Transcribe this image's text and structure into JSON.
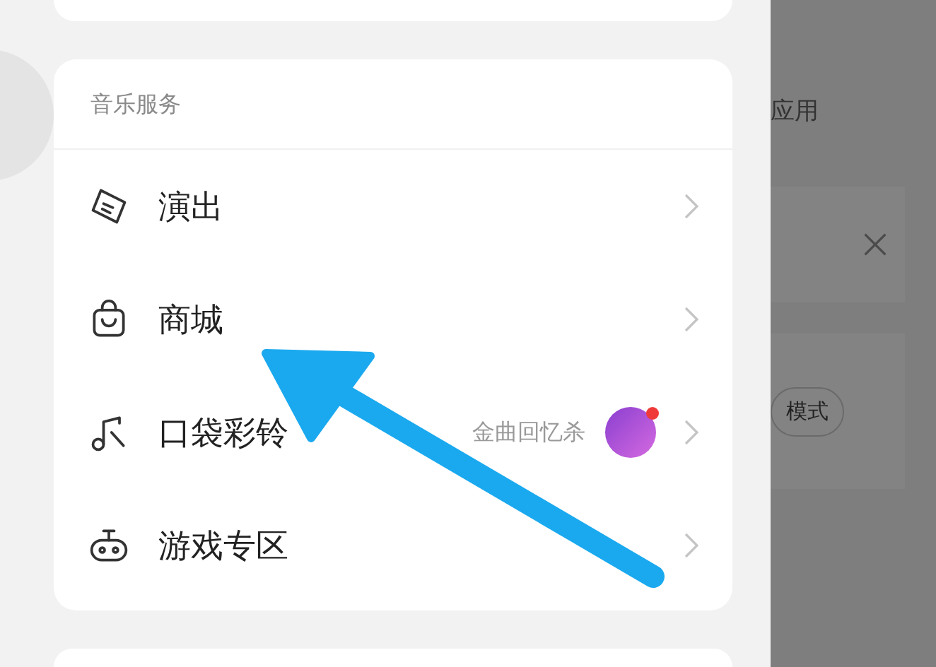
{
  "card": {
    "title": "音乐服务",
    "items": [
      {
        "kind": "ticket",
        "label": "演出"
      },
      {
        "kind": "bag",
        "label": "商城"
      },
      {
        "kind": "note",
        "label": "口袋彩铃",
        "promo": "金曲回忆杀",
        "badge": true
      },
      {
        "kind": "gamepad",
        "label": "游戏专区"
      }
    ]
  },
  "side_panel": {
    "label": "应用",
    "pill": "模式"
  }
}
